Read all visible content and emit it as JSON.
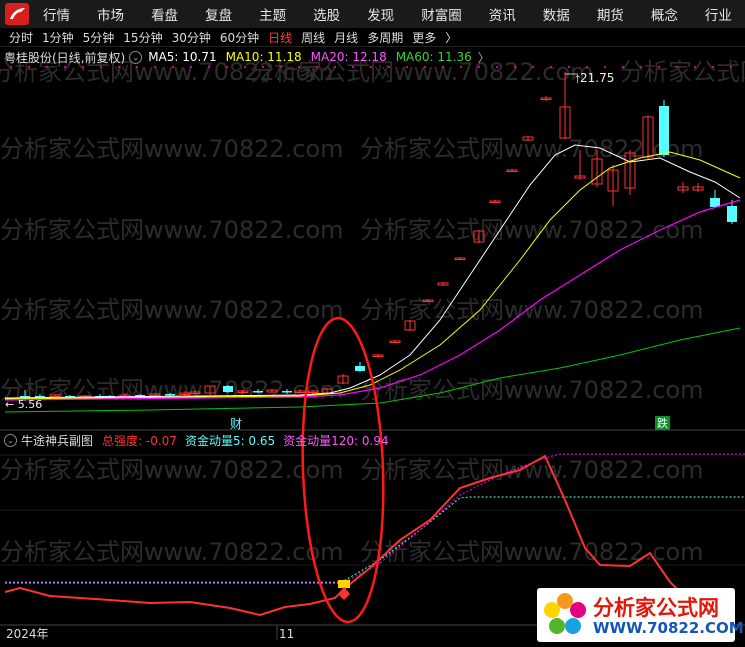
{
  "menu": [
    "行情",
    "市场",
    "看盘",
    "复盘",
    "主题",
    "选股",
    "发现",
    "财富圈",
    "资讯",
    "数据",
    "期货",
    "概念",
    "行业"
  ],
  "periods": [
    "分时",
    "1分钟",
    "5分钟",
    "15分钟",
    "30分钟",
    "60分钟",
    "日线",
    "周线",
    "月线",
    "多周期",
    "更多"
  ],
  "active_period": "日线",
  "main": {
    "stock": "粤桂股份(日线,前复权)",
    "ma5": "MA5: 10.71",
    "ma10": "MA10: 11.18",
    "ma20": "MA20: 12.18",
    "ma60": "MA60: 11.36",
    "high_label": "21.75",
    "low_label": "5.56",
    "marker_cai": "财",
    "marker_die": "跌"
  },
  "sub": {
    "title": "牛途神兵副图",
    "strength": "总强度: -0.07",
    "flow5": "资金动量5: 0.65",
    "flow120": "资金动量120: 0.94"
  },
  "axis": {
    "year": "2024年",
    "month": "11"
  },
  "watermark": "分析家公式网www.70822.com",
  "badge": {
    "title": "分析家公式网",
    "url": "WWW.70822.COM"
  },
  "colors": {
    "up": "#ff3232",
    "down": "#54ffff",
    "ma5": "#ffffff",
    "ma10": "#ffff00",
    "ma20": "#ff00ff",
    "ma60": "#00c800"
  }
}
